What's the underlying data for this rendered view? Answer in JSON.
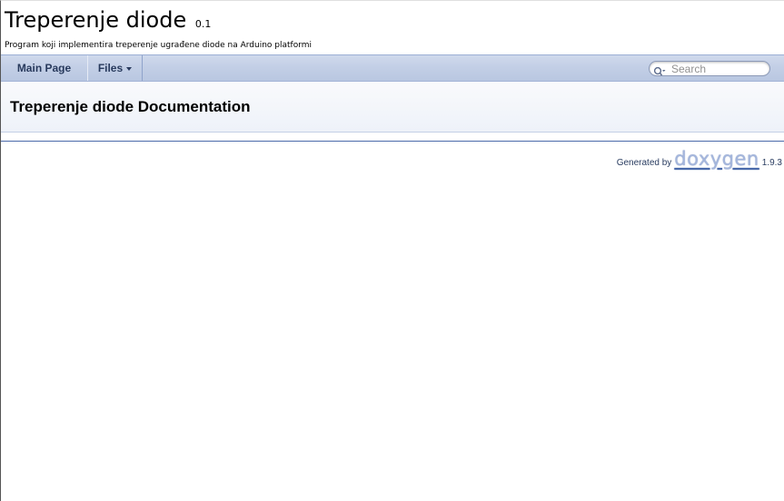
{
  "project": {
    "name": "Treperenje diode",
    "number": "0.1",
    "brief": "Program koji implementira treperenje ugrađene diode na Arduino platformi"
  },
  "nav": {
    "items": [
      {
        "label": "Main Page"
      },
      {
        "label": "Files"
      }
    ],
    "search": {
      "placeholder": "Search",
      "icon": "search-icon"
    }
  },
  "header": {
    "title": "Treperenje diode Documentation"
  },
  "footer": {
    "generated_by": "Generated by",
    "tool": "doxygen",
    "version": "1.9.3"
  },
  "colors": {
    "nav_text": "#283a5d",
    "nav_bg": "#c3cfe6",
    "footer_line": "#4a6aaa",
    "logo": "#a4b6dc"
  }
}
